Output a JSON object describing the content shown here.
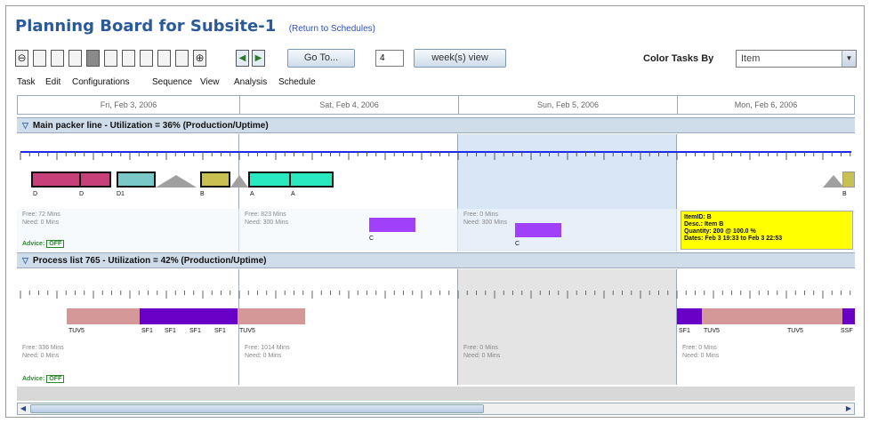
{
  "page": {
    "title": "Planning Board for Subsite-1",
    "return_link": "(Return to Schedules)"
  },
  "toolbar": {
    "zoom_out_symbol": "⊖",
    "zoom_in_symbol": "⊕",
    "zoom_level": 4,
    "zoom_steps": 10,
    "prev_icon": "◀",
    "next_icon": "▶",
    "goto_label": "Go To...",
    "weeks_value": "4",
    "view_label": "week(s) view",
    "color_by_label": "Color Tasks By",
    "color_by_value": "Item",
    "dropdown_arrow": "▼"
  },
  "menu": [
    "Task",
    "Edit",
    "Configurations",
    "Sequence",
    "View",
    "Analysis",
    "Schedule"
  ],
  "dates": [
    "Fri, Feb 3, 2006",
    "Sat, Feb 4, 2006",
    "Sun, Feb 5, 2006",
    "Mon, Feb 6, 2006"
  ],
  "sections": [
    {
      "header": "Main packer line - Utilization = 36% (Production/Uptime)",
      "columns": [
        {
          "free": "Free: 72 Mins",
          "need": "Need: 0 Mins"
        },
        {
          "free": "Free: 823 Mins",
          "need": "Need: 300 Mins"
        },
        {
          "free": "Free: 0 Mins",
          "need": "Need: 300 Mins"
        },
        {
          "free": "",
          "need": ""
        }
      ],
      "advice_label": "Advice:",
      "advice_value": "OFF",
      "task_labels": [
        "D",
        "D",
        "D1",
        "B",
        "A",
        "A",
        "B"
      ],
      "pending_labels": [
        "C",
        "C"
      ]
    },
    {
      "header": "Process list 765 - Utilization = 42% (Production/Uptime)",
      "columns": [
        {
          "free": "Free: 336 Mins",
          "need": "Need: 0 Mins"
        },
        {
          "free": "Free: 1014 Mins",
          "need": "Need: 0 Mins"
        },
        {
          "free": "Free: 0 Mins",
          "need": "Need: 0 Mins"
        },
        {
          "free": "Free: 0 Mins",
          "need": "Need: 0 Mins"
        }
      ],
      "advice_label": "Advice:",
      "advice_value": "OFF",
      "task_labels": [
        "TUV5",
        "SF1",
        "SF1",
        "SF1",
        "SF1",
        "TUV5",
        "SF1",
        "TUV5",
        "TUV5",
        "SSF"
      ]
    }
  ],
  "tooltip": {
    "lines": [
      "ItemID: B",
      "Desc.: Item B",
      "Quantity: 200 @ 100.0 %",
      "Dates: Feb 3 19:33 to Feb 3 22:53"
    ]
  },
  "scroll": {
    "left": "◀",
    "right": "▶"
  },
  "colors": {
    "pink": "#c8407a",
    "cyan": "#7ac8c8",
    "olive": "#c8c050",
    "green": "#2ae8c0",
    "purple": "#a040f8",
    "violet": "#6a00c8",
    "rose": "#d49898",
    "highlight": "#d8e6f6",
    "tooltip": "#ffff00"
  }
}
